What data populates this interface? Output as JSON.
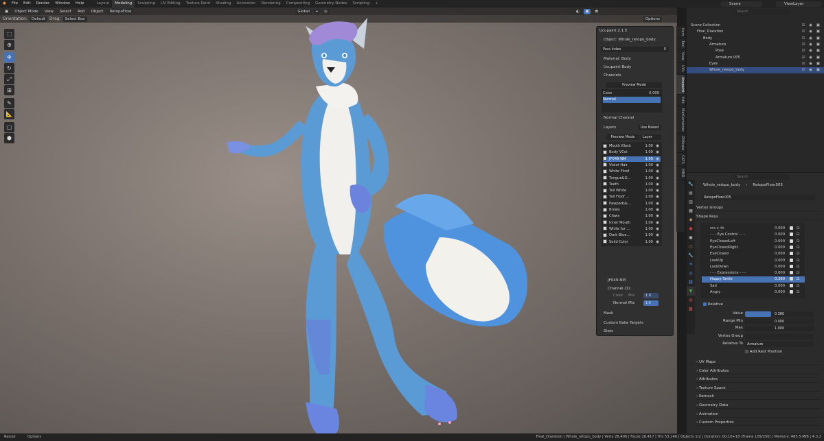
{
  "menu": [
    "File",
    "Edit",
    "Render",
    "Window",
    "Help"
  ],
  "workspaces": [
    "Layout",
    "Modeling",
    "Sculpting",
    "UV Editing",
    "Texture Paint",
    "Shading",
    "Animation",
    "Rendering",
    "Compositing",
    "Geometry Nodes",
    "Scripting"
  ],
  "active_workspace": "Modeling",
  "add_tab": "+",
  "scene": "Scene",
  "view_layer": "ViewLayer",
  "viewport": {
    "header": [
      "Object Mode",
      "View",
      "Select",
      "Add",
      "Object",
      "RetopoFlow"
    ],
    "global": "Global",
    "orientation_label": "Orientation:",
    "orientation": "Default",
    "drag_label": "Drag:",
    "drag": "Select Box",
    "options": "Options"
  },
  "sidebar_tabs": [
    "Item",
    "Tool",
    "View",
    "UVs",
    "Ucupaint",
    "Edit",
    "MatCombiner",
    "DNScale",
    "CATS",
    "MMD"
  ],
  "ucupaint": {
    "title": "Ucupaint 2.1.5",
    "object_label": "Object: Whole_retopo_body",
    "pass_index_label": "Pass Index",
    "pass_index_value": "0",
    "material": "Material: Body",
    "material_name": "Ucupaint Body",
    "channels_label": "Channels",
    "preview_mode": "Preview Mode",
    "channels": [
      {
        "name": "Color",
        "value": "0.000"
      },
      {
        "name": "Normal",
        "value": ""
      }
    ],
    "normal_channel": "Normal Channel",
    "layers_label": "Layers",
    "use_baked": "Use Baked",
    "layer_preview": "Preview Mode",
    "layer_dropdown": "Layer",
    "layers": [
      {
        "name": "Mouth Black",
        "value": "1.00"
      },
      {
        "name": "Body VCol",
        "value": "1.00"
      },
      {
        "name": "JF049-NM",
        "value": "1.00"
      },
      {
        "name": "Violet Hair",
        "value": "1.00"
      },
      {
        "name": "White Floof",
        "value": "1.00"
      },
      {
        "name": "Tongue&G...",
        "value": "1.00"
      },
      {
        "name": "Teeth",
        "value": "1.00"
      },
      {
        "name": "Tail White",
        "value": "1.00"
      },
      {
        "name": "Tail Floof ...",
        "value": "1.00"
      },
      {
        "name": "Pawpads&...",
        "value": "1.00"
      },
      {
        "name": "Brows",
        "value": "1.00"
      },
      {
        "name": "Claws",
        "value": "1.00"
      },
      {
        "name": "Inner Mouth",
        "value": "1.00"
      },
      {
        "name": "White fur ...",
        "value": "1.00"
      },
      {
        "name": "Dark Blue...",
        "value": "1.00"
      },
      {
        "name": "Solid Color",
        "value": "1.00"
      }
    ],
    "selected_layer": "JF049-NM",
    "channel_count": "Channel (1):",
    "channel_color": "Color",
    "channel_normal": "Normal",
    "mix_label": "Mix",
    "mix_value": "1.0",
    "mask_label": "Mask",
    "custom_bake": "Custom Bake Targets",
    "stats": "Stats"
  },
  "outliner": {
    "search_placeholder": "Search",
    "rows": [
      {
        "name": "Scene Collection",
        "indent": 0
      },
      {
        "name": "Final_Diaration",
        "indent": 1
      },
      {
        "name": "Body",
        "indent": 2
      },
      {
        "name": "Armature",
        "indent": 3
      },
      {
        "name": "Pose",
        "indent": 4
      },
      {
        "name": "Armature.005",
        "indent": 4
      },
      {
        "name": "Eyes",
        "indent": 3
      },
      {
        "name": "Whole_retopo_body",
        "indent": 3
      }
    ]
  },
  "properties": {
    "search_placeholder": "Search",
    "object": "Whole_retopo_body",
    "mesh": "RetopoFlow.005",
    "mesh_field": "RetopoFlow.005",
    "vertex_groups": "Vertex Groups",
    "shape_keys": "Shape Keys",
    "keys": [
      {
        "name": "vrc.v_th",
        "value": "0.000"
      },
      {
        "name": "- - - Eye Control - - -",
        "value": "0.000"
      },
      {
        "name": "EyeClosedLeft",
        "value": "0.000"
      },
      {
        "name": "EyeClosedRight",
        "value": "0.000"
      },
      {
        "name": "EyeClosed",
        "value": "0.000"
      },
      {
        "name": "LookUp",
        "value": "0.000"
      },
      {
        "name": "LookDown",
        "value": "0.000"
      },
      {
        "name": "- - - Expressions - - -",
        "value": "0.000"
      },
      {
        "name": "Happy Smile",
        "value": "0.380"
      },
      {
        "name": "Sad",
        "value": "0.000"
      },
      {
        "name": "Angry",
        "value": "0.000"
      }
    ],
    "relative": "Relative",
    "value_label": "Value",
    "value": "0.380",
    "value_fraction": 0.38,
    "range_min_label": "Range Min",
    "range_min": "0.000",
    "max_label": "Max",
    "max": "1.000",
    "vertex_group_label": "Vertex Group",
    "relative_to_label": "Relative To",
    "relative_to": "Armature",
    "add_rest": "Add Rest Position",
    "sections": [
      "UV Maps",
      "Color Attributes",
      "Attributes",
      "Texture Space",
      "Remesh",
      "Geometry Data",
      "Animation",
      "Custom Properties"
    ]
  },
  "status": {
    "left": [
      "Resize",
      "Options"
    ],
    "right": "Final_Diaration | Whole_retopo_body | Verts 26,406 | Faces 26,417 | Tris 53,146 | Objects 1/2 | Duration: 00:10+10 (Frame 109/250) | Memory: 485.5 MiB | 4.3.2"
  },
  "colors": {
    "accent": "#4772b3",
    "body": "#5b9bd5",
    "fur": "#f2f0ec",
    "hair": "#a08ad8",
    "paws": "#5f7fdc"
  }
}
